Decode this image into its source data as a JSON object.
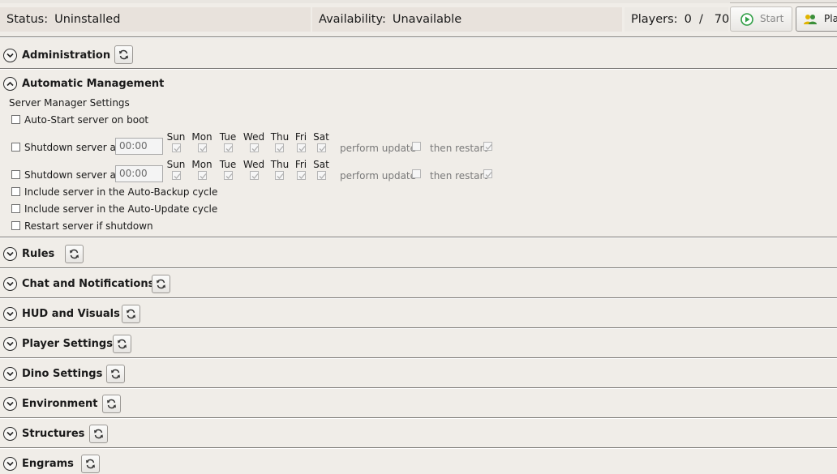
{
  "status": {
    "label": "Status:",
    "value": "Uninstalled"
  },
  "availability": {
    "label": "Availability:",
    "value": "Unavailable"
  },
  "players": {
    "label": "Players:",
    "current": "0",
    "separator": "/",
    "max": "70"
  },
  "buttons": {
    "start": "Start",
    "players": "Pla"
  },
  "sections": {
    "administration": "Administration",
    "automatic_management": "Automatic Management",
    "rules": "Rules",
    "chat": "Chat and Notifications",
    "hud": "HUD and Visuals",
    "player": "Player Settings",
    "dino": "Dino Settings",
    "environment": "Environment",
    "structures": "Structures",
    "engrams": "Engrams"
  },
  "auto": {
    "group_title": "Server Manager Settings",
    "auto_start": "Auto-Start server on boot",
    "shutdown_label": "Shutdown server at",
    "shutdown1_time": "00:00",
    "shutdown2_time": "00:00",
    "days": [
      "Sun",
      "Mon",
      "Tue",
      "Wed",
      "Thu",
      "Fri",
      "Sat"
    ],
    "perform_update": "perform update",
    "then_restart": "then restart",
    "backup": "Include server in the Auto-Backup cycle",
    "update": "Include server in the Auto-Update cycle",
    "restart": "Restart server if shutdown"
  },
  "icons": {
    "start": "play-circle-icon",
    "players": "users-icon",
    "refresh": "refresh-icon",
    "expand": "chevron-down-icon",
    "collapse": "chevron-up-icon"
  },
  "colors": {
    "start_icon": "#2e9e44",
    "background": "#f0ede8",
    "status_bg": "#e8e2dc"
  }
}
